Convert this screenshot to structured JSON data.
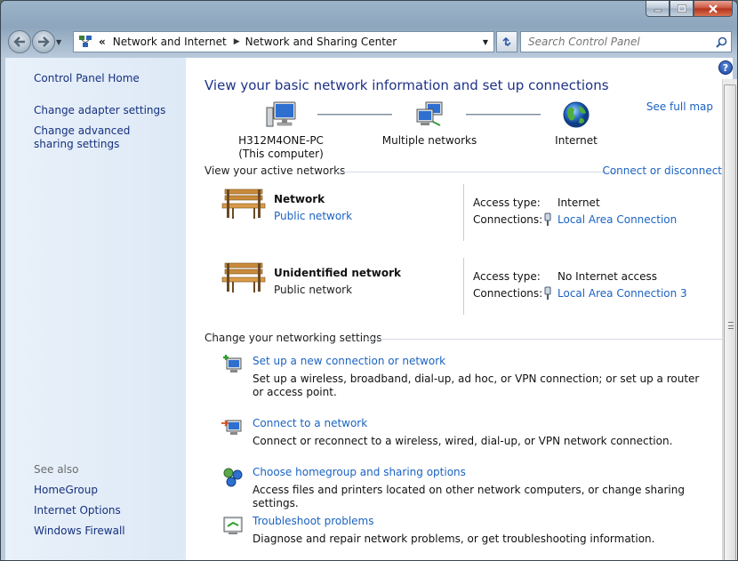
{
  "window": {
    "minimize_icon": "minimize-icon",
    "maximize_icon": "maximize-icon",
    "close_icon": "close-icon"
  },
  "nav": {
    "breadcrumbs": [
      "Network and Internet",
      "Network and Sharing Center"
    ],
    "overflow": "«",
    "search_placeholder": "Search Control Panel"
  },
  "sidebar": {
    "home": "Control Panel Home",
    "tasks": [
      "Change adapter settings",
      "Change advanced sharing settings"
    ],
    "see_also_label": "See also",
    "see_also": [
      "HomeGroup",
      "Internet Options",
      "Windows Firewall"
    ]
  },
  "main": {
    "title": "View your basic network information and set up connections",
    "see_full_map": "See full map",
    "help": "?",
    "map": [
      {
        "line1": "H312M4ONE-PC",
        "line2": "(This computer)"
      },
      {
        "line1": "Multiple networks",
        "line2": ""
      },
      {
        "line1": "Internet",
        "line2": ""
      }
    ],
    "active_networks_label": "View your active networks",
    "connect_or_disconnect": "Connect or disconnect",
    "networks": [
      {
        "name": "Network",
        "type": "Public network",
        "type_is_link": true,
        "access_label": "Access type:",
        "access": "Internet",
        "connections_label": "Connections:",
        "connection": "Local Area Connection"
      },
      {
        "name": "Unidentified network",
        "type": "Public network",
        "type_is_link": false,
        "access_label": "Access type:",
        "access": "No Internet access",
        "connections_label": "Connections:",
        "connection": "Local Area Connection 3"
      }
    ],
    "settings_label": "Change your networking settings",
    "tasks": [
      {
        "link": "Set up a new connection or network",
        "desc": "Set up a wireless, broadband, dial-up, ad hoc, or VPN connection; or set up a router or access point."
      },
      {
        "link": "Connect to a network",
        "desc": "Connect or reconnect to a wireless, wired, dial-up, or VPN network connection."
      },
      {
        "link": "Choose homegroup and sharing options",
        "desc": "Access files and printers located on other network computers, or change sharing settings."
      },
      {
        "link": "Troubleshoot problems",
        "desc": "Diagnose and repair network problems, or get troubleshooting information."
      }
    ]
  },
  "colors": {
    "link": "#1b63c2",
    "title": "#1e3287",
    "sidebar_bg": "#dde9f6"
  }
}
